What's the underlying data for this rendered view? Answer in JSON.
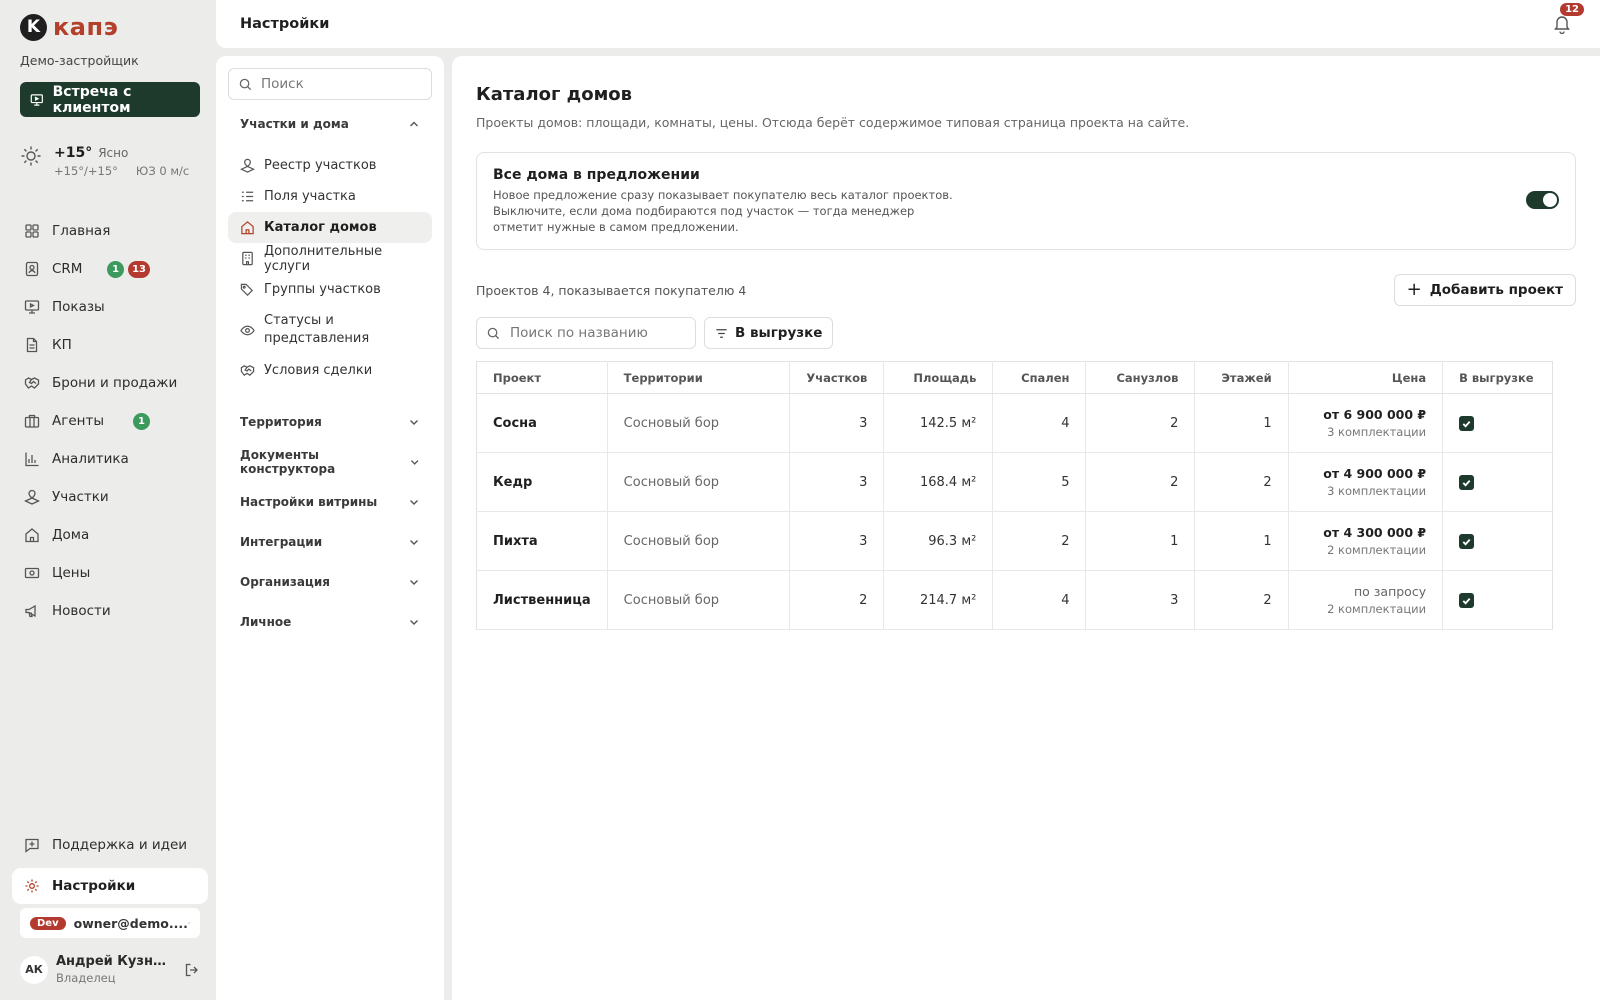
{
  "app": {
    "logo_letter": "K",
    "logo_text": "капэ",
    "company": "Демо-застройщик",
    "meet_button": "Встреча с клиентом"
  },
  "weather": {
    "temp": "+15°",
    "desc": "Ясно",
    "range": "+15°/+15°",
    "wind": "ЮЗ 0 м/с"
  },
  "nav": [
    {
      "label": "Главная",
      "icon": "grid-icon"
    },
    {
      "label": "CRM",
      "icon": "contact-icon",
      "badge_green": "1",
      "badge_red": "13"
    },
    {
      "label": "Показы",
      "icon": "monitor-icon"
    },
    {
      "label": "КП",
      "icon": "document-icon"
    },
    {
      "label": "Брони и продажи",
      "icon": "handshake-icon"
    },
    {
      "label": "Агенты",
      "icon": "briefcase-icon",
      "badge_green": "1"
    },
    {
      "label": "Аналитика",
      "icon": "bar-chart-icon"
    },
    {
      "label": "Участки",
      "icon": "plot-icon"
    },
    {
      "label": "Дома",
      "icon": "home-icon"
    },
    {
      "label": "Цены",
      "icon": "price-icon"
    },
    {
      "label": "Новости",
      "icon": "megaphone-icon"
    }
  ],
  "bottom_nav": {
    "support": "Поддержка и идеи",
    "settings": "Настройки"
  },
  "user": {
    "env_tag": "Dev",
    "email": "owner@demo....",
    "initials": "АК",
    "name": "Андрей Кузне...",
    "role": "Владелец"
  },
  "header": {
    "title": "Настройки",
    "notifications": "12"
  },
  "settings": {
    "search_placeholder": "Поиск",
    "sections": [
      {
        "title": "Участки и дома",
        "expanded": true
      },
      {
        "title": "Территория"
      },
      {
        "title": "Документы конструктора"
      },
      {
        "title": "Настройки витрины"
      },
      {
        "title": "Интеграции"
      },
      {
        "title": "Организация"
      },
      {
        "title": "Личное"
      }
    ],
    "items": [
      {
        "label": "Реестр участков",
        "icon": "plot-icon"
      },
      {
        "label": "Поля участка",
        "icon": "list-icon"
      },
      {
        "label": "Каталог домов",
        "icon": "home-icon",
        "active": true
      },
      {
        "label": "Дополнительные услуги",
        "icon": "building-icon"
      },
      {
        "label": "Группы участков",
        "icon": "tags-icon"
      },
      {
        "label": "Статусы и представления",
        "icon": "eye-icon"
      },
      {
        "label": "Условия сделки",
        "icon": "handshake-icon"
      }
    ]
  },
  "main": {
    "title": "Каталог домов",
    "subtitle": "Проекты домов: площади, комнаты, цены. Отсюда берёт содержимое типовая страница проекта на сайте.",
    "card": {
      "title": "Все дома в предложении",
      "text": "Новое предложение сразу показывает покупателю весь каталог проектов. Выключите, если дома подбираются под участок — тогда менеджер отметит нужные в самом предложении.",
      "toggle_on": true
    },
    "summary": "Проектов 4, показывается покупателю 4",
    "add_button": "Добавить проект",
    "table_search_placeholder": "Поиск по названию",
    "filter_button": "В выгрузке"
  },
  "table": {
    "columns": [
      "Проект",
      "Территории",
      "Участков",
      "Площадь",
      "Спален",
      "Санузлов",
      "Этажей",
      "Цена",
      "В выгрузке"
    ],
    "rows": [
      {
        "name": "Сосна",
        "territory": "Сосновый бор",
        "plots": "3",
        "area": "142.5 м²",
        "bedrooms": "4",
        "bathrooms": "2",
        "floors": "1",
        "price": "от 6 900 000 ₽",
        "sets": "3 комплектации",
        "exported": true
      },
      {
        "name": "Кедр",
        "territory": "Сосновый бор",
        "plots": "3",
        "area": "168.4 м²",
        "bedrooms": "5",
        "bathrooms": "2",
        "floors": "2",
        "price": "от 4 900 000 ₽",
        "sets": "3 комплектации",
        "exported": true
      },
      {
        "name": "Пихта",
        "territory": "Сосновый бор",
        "plots": "3",
        "area": "96.3 м²",
        "bedrooms": "2",
        "bathrooms": "1",
        "floors": "1",
        "price": "от 4 300 000 ₽",
        "sets": "2 комплектации",
        "exported": true
      },
      {
        "name": "Лиственница",
        "territory": "Сосновый бор",
        "plots": "2",
        "area": "214.7 м²",
        "bedrooms": "4",
        "bathrooms": "3",
        "floors": "2",
        "price": "по запросу",
        "sets": "2 комплектации",
        "exported": true,
        "price_on_request": true
      }
    ]
  },
  "colors": {
    "accent": "#1d3a2c",
    "brand": "#b3402a",
    "badge_red": "#b43a2f",
    "badge_green": "#3d9a5f"
  }
}
